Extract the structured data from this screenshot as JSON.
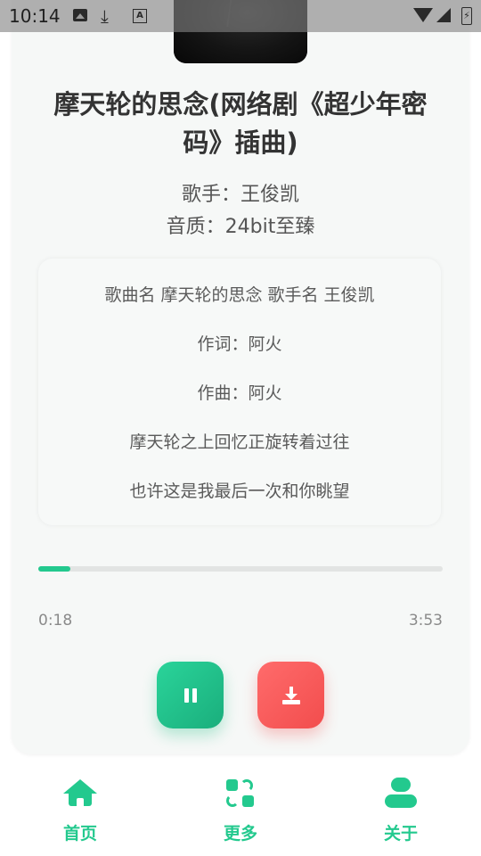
{
  "status_bar": {
    "time": "10:14",
    "download_glyph": "⤓",
    "a_glyph": "A",
    "battery_glyph": "⚡",
    "icons": [
      "image-icon",
      "download-icon",
      "a-icon",
      "wifi-icon",
      "signal-icon",
      "battery-icon"
    ]
  },
  "song": {
    "title": "摩天轮的思念(网络剧《超少年密码》插曲)",
    "singer": "歌手：王俊凯",
    "quality": "音质：24bit至臻"
  },
  "lyrics": {
    "lines": [
      "歌曲名 摩天轮的思念 歌手名 王俊凯",
      "作词：阿火",
      "作曲：阿火",
      "摩天轮之上回忆正旋转着过往",
      "也许这是我最后一次和你眺望"
    ],
    "active_index": 2
  },
  "player": {
    "current_time": "0:18",
    "total_time": "3:53",
    "progress_fraction": 0.08
  },
  "controls": {
    "pause_icon": "pause-icon",
    "download_icon": "download-icon"
  },
  "nav": {
    "items": [
      {
        "label": "首页",
        "icon": "home-icon"
      },
      {
        "label": "更多",
        "icon": "swap-icon"
      },
      {
        "label": "关于",
        "icon": "user-icon"
      }
    ]
  },
  "colors": {
    "accent": "#23c98e",
    "danger": "#f24d4d",
    "card": "#f6f8f7",
    "title": "#333333"
  }
}
